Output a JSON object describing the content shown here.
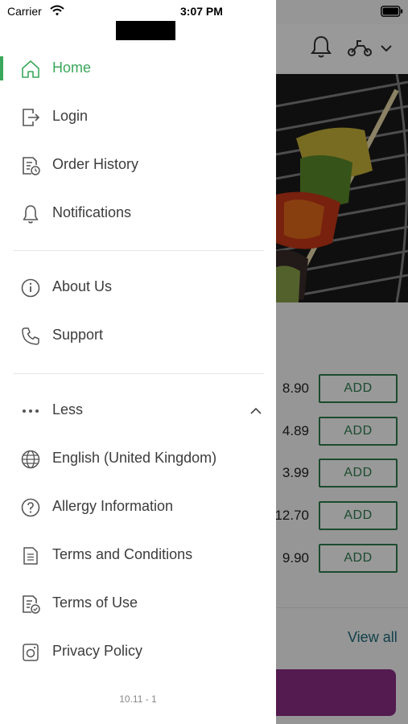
{
  "status_bar": {
    "carrier": "Carrier",
    "time": "3:07 PM"
  },
  "menu": {
    "items": [
      {
        "label": "Home",
        "icon": "home-icon",
        "active": true
      },
      {
        "label": "Login",
        "icon": "login-icon"
      },
      {
        "label": "Order History",
        "icon": "order-history-icon"
      },
      {
        "label": "Notifications",
        "icon": "bell-icon"
      },
      {
        "label": "About Us",
        "icon": "info-icon"
      },
      {
        "label": "Support",
        "icon": "phone-icon"
      },
      {
        "label": "Less",
        "icon": "more-dots-icon"
      },
      {
        "label": "English (United Kingdom)",
        "icon": "globe-icon"
      },
      {
        "label": "Allergy Information",
        "icon": "question-icon"
      },
      {
        "label": "Terms and Conditions",
        "icon": "document-icon"
      },
      {
        "label": "Terms of Use",
        "icon": "document-check-icon"
      },
      {
        "label": "Privacy Policy",
        "icon": "privacy-icon"
      }
    ],
    "version": "10.11 - 1"
  },
  "background": {
    "prices": [
      "8.90",
      "4.89",
      "3.99",
      "12.70",
      "9.90"
    ],
    "add_label": "ADD",
    "view_all": "View all"
  },
  "colors": {
    "accent": "#3aa75a",
    "add_border": "#2e7d4f",
    "cta": "#8a2d86",
    "link": "#1f6b7d"
  }
}
